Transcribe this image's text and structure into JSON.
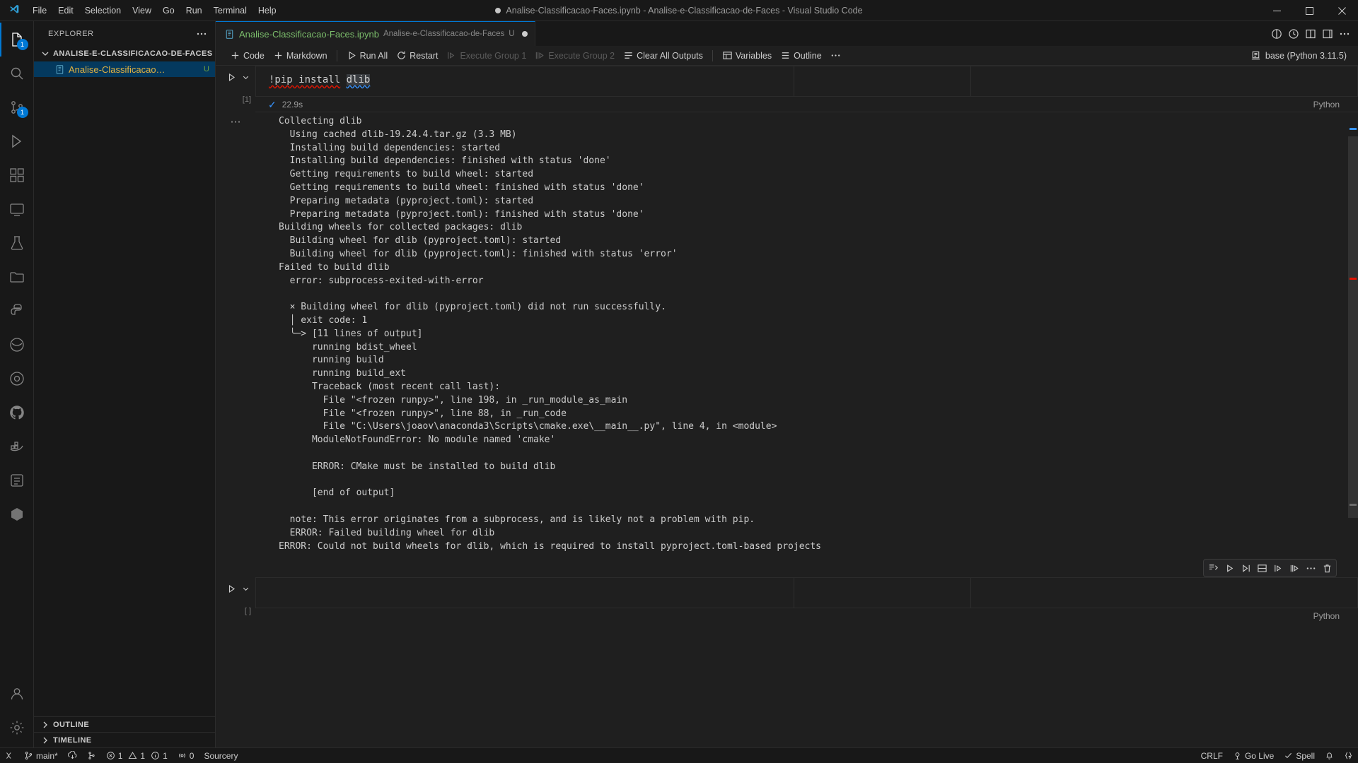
{
  "titlebar": {
    "menus": [
      "File",
      "Edit",
      "Selection",
      "View",
      "Go",
      "Run",
      "Terminal",
      "Help"
    ],
    "title": "Analise-Classificacao-Faces.ipynb - Analise-e-Classificacao-de-Faces - Visual Studio Code",
    "dirty": true
  },
  "activitybar": {
    "items": [
      {
        "name": "explorer",
        "badge": "1",
        "active": true
      },
      {
        "name": "search",
        "badge": "",
        "active": false
      },
      {
        "name": "source-control",
        "badge": "1",
        "active": false
      },
      {
        "name": "run-and-debug",
        "badge": "",
        "active": false
      },
      {
        "name": "extensions",
        "badge": "",
        "active": false
      },
      {
        "name": "remote-explorer",
        "badge": "",
        "active": false
      },
      {
        "name": "testing",
        "badge": "",
        "active": false
      },
      {
        "name": "project-manager",
        "badge": "",
        "active": false
      },
      {
        "name": "python-environments",
        "badge": "",
        "active": false
      },
      {
        "name": "jupyter",
        "badge": "",
        "active": false
      },
      {
        "name": "sourcery",
        "badge": "",
        "active": false
      },
      {
        "name": "github",
        "badge": "",
        "active": false
      },
      {
        "name": "docker",
        "badge": "",
        "active": false
      },
      {
        "name": "todo-tree",
        "badge": "",
        "active": false
      },
      {
        "name": "database",
        "badge": "",
        "active": false
      }
    ],
    "bottom": [
      {
        "name": "accounts"
      },
      {
        "name": "settings"
      }
    ]
  },
  "sidebar": {
    "title": "EXPLORER",
    "more_label": "···",
    "root_folder": "ANALISE-E-CLASSIFICACAO-DE-FACES",
    "files": [
      {
        "name": "Analise-Classificacao…",
        "badge": "U",
        "selected": true
      }
    ],
    "panels": [
      "OUTLINE",
      "TIMELINE"
    ]
  },
  "editor": {
    "tab": {
      "label": "Analise-Classificacao-Faces.ipynb",
      "description": "Analise-e-Classificacao-de-Faces",
      "badge": "U",
      "dirty": true
    },
    "toolbar": {
      "code": "Code",
      "markdown": "Markdown",
      "run_all": "Run All",
      "restart": "Restart",
      "execute_group_1": "Execute Group 1",
      "execute_group_2": "Execute Group 2",
      "clear_all_outputs": "Clear All Outputs",
      "variables": "Variables",
      "outline": "Outline",
      "more": "···",
      "kernel": "base (Python 3.11.5)"
    },
    "cells": [
      {
        "exec_count": "[1]",
        "language": "Python",
        "duration": "22.9s",
        "status": "success",
        "code_prefix": "!pip install ",
        "code_error_word": "!pip install",
        "code_highlight": "dlib",
        "output": [
          "Collecting dlib",
          "  Using cached dlib-19.24.4.tar.gz (3.3 MB)",
          "  Installing build dependencies: started",
          "  Installing build dependencies: finished with status 'done'",
          "  Getting requirements to build wheel: started",
          "  Getting requirements to build wheel: finished with status 'done'",
          "  Preparing metadata (pyproject.toml): started",
          "  Preparing metadata (pyproject.toml): finished with status 'done'",
          "Building wheels for collected packages: dlib",
          "  Building wheel for dlib (pyproject.toml): started",
          "  Building wheel for dlib (pyproject.toml): finished with status 'error'",
          "Failed to build dlib",
          "  error: subprocess-exited-with-error",
          "",
          "  × Building wheel for dlib (pyproject.toml) did not run successfully.",
          "  │ exit code: 1",
          "  ╰─> [11 lines of output]",
          "      running bdist_wheel",
          "      running build",
          "      running build_ext",
          "      Traceback (most recent call last):",
          "        File \"<frozen runpy>\", line 198, in _run_module_as_main",
          "        File \"<frozen runpy>\", line 88, in _run_code",
          "        File \"C:\\Users\\joaov\\anaconda3\\Scripts\\cmake.exe\\__main__.py\", line 4, in <module>",
          "      ModuleNotFoundError: No module named 'cmake'",
          "",
          "      ERROR: CMake must be installed to build dlib",
          "",
          "      [end of output]",
          "",
          "  note: This error originates from a subprocess, and is likely not a problem with pip.",
          "  ERROR: Failed building wheel for dlib",
          "ERROR: Could not build wheels for dlib, which is required to install pyproject.toml-based projects"
        ]
      },
      {
        "exec_count": "[ ]",
        "language": "Python",
        "code_prefix": "",
        "output": []
      }
    ]
  },
  "statusbar": {
    "left": [
      {
        "name": "remote-window",
        "label": ""
      },
      {
        "name": "branch",
        "label": "main*"
      },
      {
        "name": "sync",
        "label": ""
      },
      {
        "name": "git-graph",
        "label": ""
      },
      {
        "name": "errors",
        "label": "1"
      },
      {
        "name": "warnings",
        "label": "1"
      },
      {
        "name": "infos",
        "label": "1"
      },
      {
        "name": "ports",
        "label": "0"
      },
      {
        "name": "sourcery",
        "label": "Sourcery"
      }
    ],
    "right": [
      {
        "name": "eol",
        "label": "CRLF"
      },
      {
        "name": "go-live",
        "label": "Go Live"
      },
      {
        "name": "spell",
        "label": "Spell"
      },
      {
        "name": "notifications",
        "label": ""
      },
      {
        "name": "braces",
        "label": ""
      }
    ]
  },
  "colors": {
    "accent": "#0078d4",
    "bg": "#1f1f1f",
    "chrome": "#181818",
    "error": "#e51400",
    "text": "#cccccc"
  }
}
